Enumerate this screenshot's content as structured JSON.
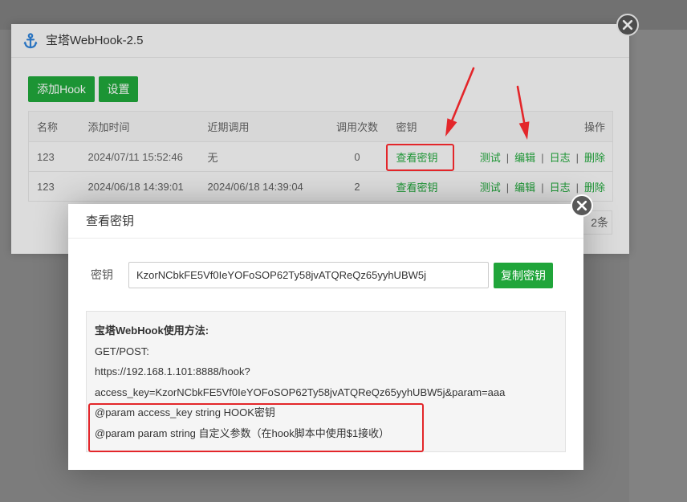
{
  "background_dialog": {
    "title": "宝塔WebHook-2.5",
    "toolbar": {
      "add_label": "添加Hook",
      "settings_label": "设置"
    },
    "table": {
      "headers": [
        "名称",
        "添加时间",
        "近期调用",
        "调用次数",
        "密钥",
        "操作"
      ],
      "action_separator": "|",
      "rows": [
        {
          "name": "123",
          "added": "2024/07/11 15:52:46",
          "recent": "无",
          "count": "0",
          "key_link": "查看密钥",
          "actions": [
            "测试",
            "编辑",
            "日志",
            "删除"
          ]
        },
        {
          "name": "123",
          "added": "2024/06/18 14:39:01",
          "recent": "2024/06/18 14:39:04",
          "count": "2",
          "key_link": "查看密钥",
          "actions": [
            "测试",
            "编辑",
            "日志",
            "删除"
          ]
        }
      ]
    },
    "pagination": {
      "total_text": "2条"
    }
  },
  "key_modal": {
    "title": "查看密钥",
    "key_label": "密钥",
    "key_value": "KzorNCbkFE5Vf0IeYOFoSOP62Ty58jvATQReQz65yyhUBW5j",
    "copy_label": "复制密钥",
    "usage": {
      "heading": "宝塔WebHook使用方法:",
      "lines": [
        "GET/POST:",
        "https://192.168.1.101:8888/hook?",
        "access_key=KzorNCbkFE5Vf0IeYOFoSOP62Ty58jvATQReQz65yyhUBW5j&param=aaa",
        "@param access_key string HOOK密钥",
        "@param param string 自定义参数（在hook脚本中使用$1接收）"
      ]
    }
  },
  "icons": {
    "title_icon": "anchor-icon",
    "close_icon": "close-icon"
  },
  "colors": {
    "accent_green": "#20a53a",
    "annotation_red": "#e3262a",
    "anchor_blue": "#2b74c0"
  }
}
